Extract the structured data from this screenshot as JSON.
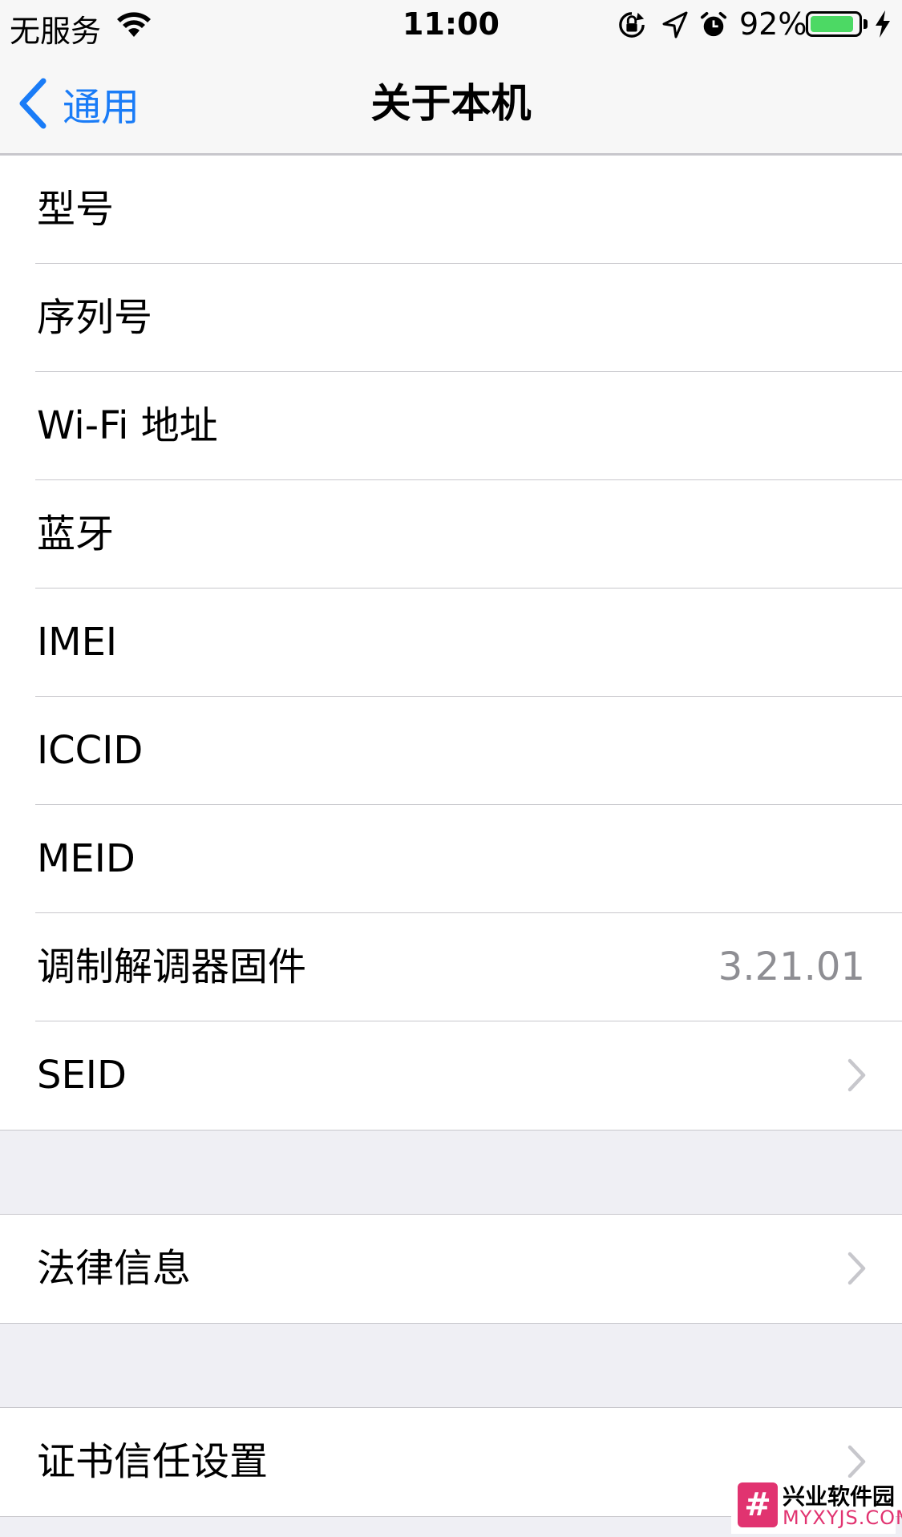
{
  "status_bar": {
    "carrier": "无服务",
    "time": "11:00",
    "battery_percent": "92%",
    "battery_level": 0.92,
    "battery_color": "#4cd964",
    "icons": [
      "wifi-icon",
      "orientation-lock-icon",
      "location-arrow-icon",
      "alarm-icon",
      "battery-icon",
      "charging-bolt-icon"
    ]
  },
  "nav": {
    "back_label": "通用",
    "title": "关于本机",
    "tint_color": "#1a7cf7"
  },
  "sections": [
    {
      "rows": [
        {
          "label": "型号",
          "value": ""
        },
        {
          "label": "序列号",
          "value": ""
        },
        {
          "label": "Wi-Fi 地址",
          "value": ""
        },
        {
          "label": "蓝牙",
          "value": ""
        },
        {
          "label": "IMEI",
          "value": ""
        },
        {
          "label": "ICCID",
          "value": ""
        },
        {
          "label": "MEID",
          "value": ""
        },
        {
          "label": "调制解调器固件",
          "value": "3.21.01"
        },
        {
          "label": "SEID",
          "value": "",
          "chevron": true
        }
      ]
    },
    {
      "rows": [
        {
          "label": "法律信息",
          "value": "",
          "chevron": true
        }
      ]
    },
    {
      "rows": [
        {
          "label": "证书信任设置",
          "value": "",
          "chevron": true
        }
      ]
    }
  ],
  "watermark": {
    "badge": "#",
    "name_cn": "兴业软件园",
    "name_en": "MYXYJS.COM"
  }
}
